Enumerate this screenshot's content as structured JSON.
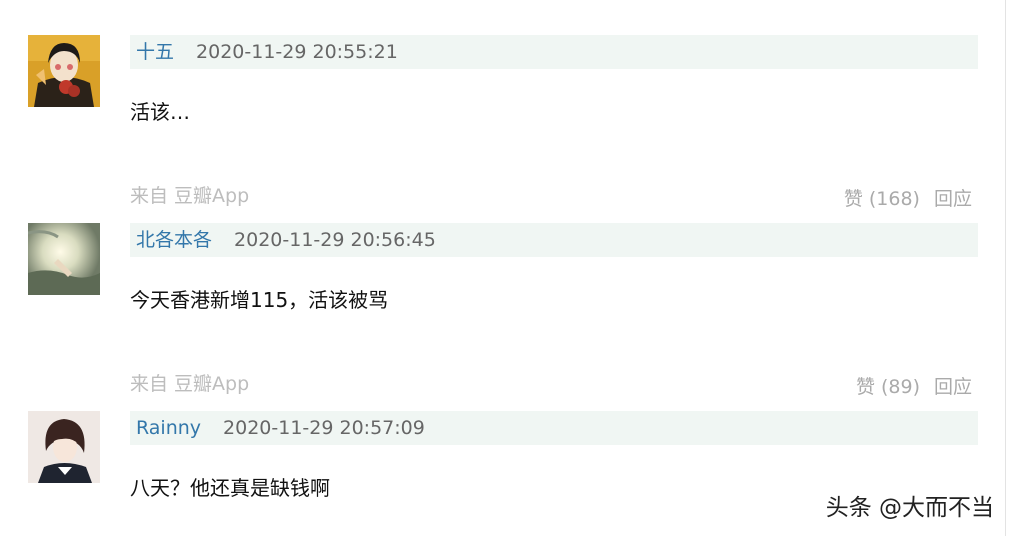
{
  "comments": [
    {
      "author": "十五",
      "time": "2020-11-29 20:55:21",
      "content": "活该…",
      "source": "来自 豆瓣App",
      "like_label": "赞 (168)",
      "reply_label": "回应"
    },
    {
      "author": "北各本各",
      "time": "2020-11-29 20:56:45",
      "content": "今天香港新增115，活该被骂",
      "source": "来自 豆瓣App",
      "like_label": "赞 (89)",
      "reply_label": "回应"
    },
    {
      "author": "Rainny",
      "time": "2020-11-29 20:57:09",
      "content": "八天？他还真是缺钱啊"
    }
  ],
  "watermark": "头条 @大而不当"
}
